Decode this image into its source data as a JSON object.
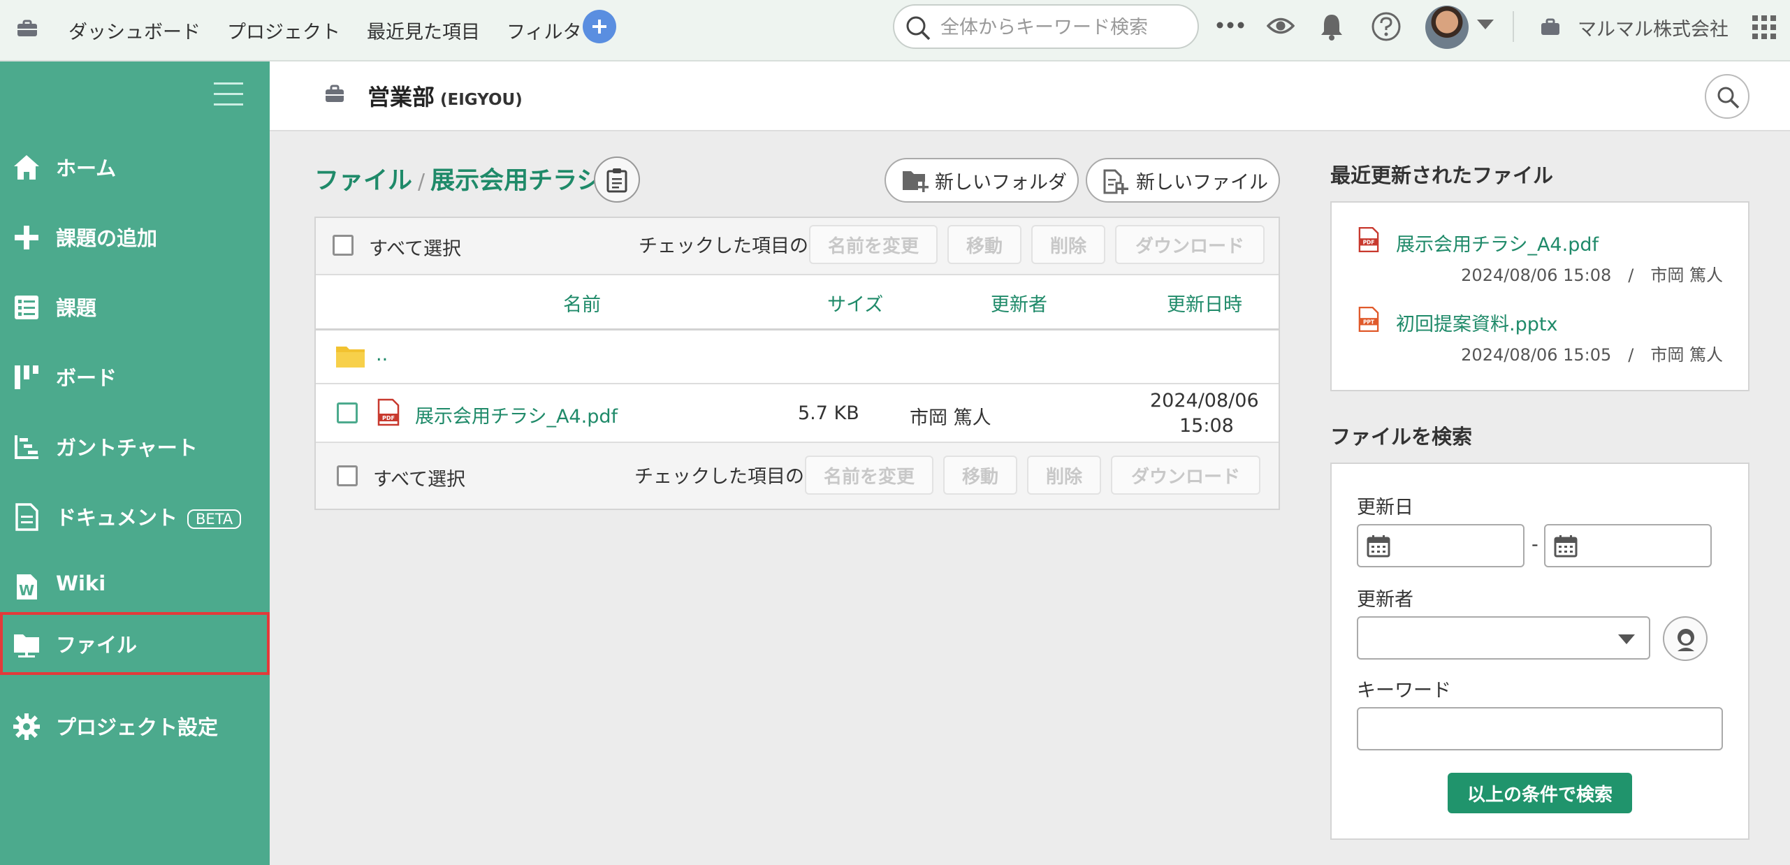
{
  "topnav": {
    "items": [
      "ダッシュボード",
      "プロジェクト",
      "最近見た項目",
      "フィルタ"
    ],
    "search_placeholder": "全体からキーワード検索",
    "company": "マルマル株式会社"
  },
  "sidebar": {
    "items": [
      {
        "label": "ホーム",
        "icon": "home-icon"
      },
      {
        "label": "課題の追加",
        "icon": "plus-icon"
      },
      {
        "label": "課題",
        "icon": "list-icon"
      },
      {
        "label": "ボード",
        "icon": "board-icon"
      },
      {
        "label": "ガントチャート",
        "icon": "gantt-icon"
      },
      {
        "label": "ドキュメント",
        "icon": "document-icon",
        "badge": "BETA"
      },
      {
        "label": "Wiki",
        "icon": "wiki-icon"
      },
      {
        "label": "ファイル",
        "icon": "folder-icon",
        "active": true
      },
      {
        "label": "プロジェクト設定",
        "icon": "gear-icon"
      }
    ]
  },
  "project": {
    "name": "営業部",
    "key": "(EIGYOU)"
  },
  "breadcrumb": {
    "root": "ファイル",
    "sep": "/",
    "current": "展示会用チラシ"
  },
  "actions": {
    "new_folder": "新しいフォルダ",
    "new_file": "新しいファイル"
  },
  "bulk": {
    "select_all": "すべて選択",
    "checked_label": "チェックした項目の",
    "rename": "名前を変更",
    "move": "移動",
    "delete": "削除",
    "download": "ダウンロード"
  },
  "table": {
    "headers": {
      "name": "名前",
      "size": "サイズ",
      "updater": "更新者",
      "updated": "更新日時"
    },
    "parent": "..",
    "rows": [
      {
        "name": "展示会用チラシ_A4.pdf",
        "size": "5.7 KB",
        "updater": "市岡 篤人",
        "date": "2024/08/06",
        "time": "15:08"
      }
    ]
  },
  "recent": {
    "title": "最近更新されたファイル",
    "files": [
      {
        "name": "展示会用チラシ_A4.pdf",
        "meta": "2024/08/06 15:08　/　市岡 篤人",
        "type": "PDF"
      },
      {
        "name": "初回提案資料.pptx",
        "meta": "2024/08/06 15:05　/　市岡 篤人",
        "type": "PPT"
      }
    ]
  },
  "search_panel": {
    "title": "ファイルを検索",
    "updated_label": "更新日",
    "range_sep": "-",
    "updater_label": "更新者",
    "keyword_label": "キーワード",
    "submit": "以上の条件で検索"
  }
}
